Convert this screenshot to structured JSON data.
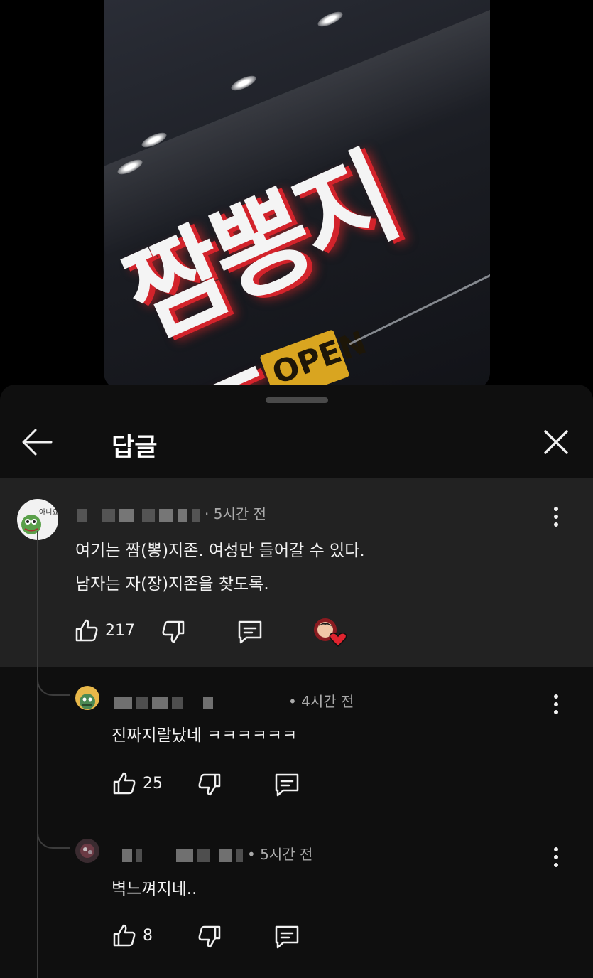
{
  "media": {
    "sign_text": "짬뽕지존",
    "door_sign": "OPEN"
  },
  "sheet": {
    "title": "답글"
  },
  "comments": [
    {
      "time": "· 5시간 전",
      "text_lines": [
        "여기는 짬(뽕)지존. 여성만 들어갈 수 있다.",
        "남자는 자(장)지존을 찾도록."
      ],
      "likes": "217",
      "avatar_label": "아니요"
    },
    {
      "time": "• 4시간 전",
      "text_lines": [
        "진짜지랄났네 ㅋㅋㅋㅋㅋㅋ"
      ],
      "likes": "25"
    },
    {
      "time": "• 5시간 전",
      "text_lines": [
        "벽느껴지네.."
      ],
      "likes": "8"
    }
  ],
  "colors": {
    "sheet_bg": "#0f0f0f",
    "highlight_bg": "#222222",
    "heart": "#e0242f",
    "sign_red": "#d3232b"
  },
  "icons": [
    "back-arrow-icon",
    "close-icon",
    "thumbs-up-icon",
    "thumbs-down-icon",
    "reply-icon",
    "more-vert-icon",
    "creator-heart-icon"
  ]
}
